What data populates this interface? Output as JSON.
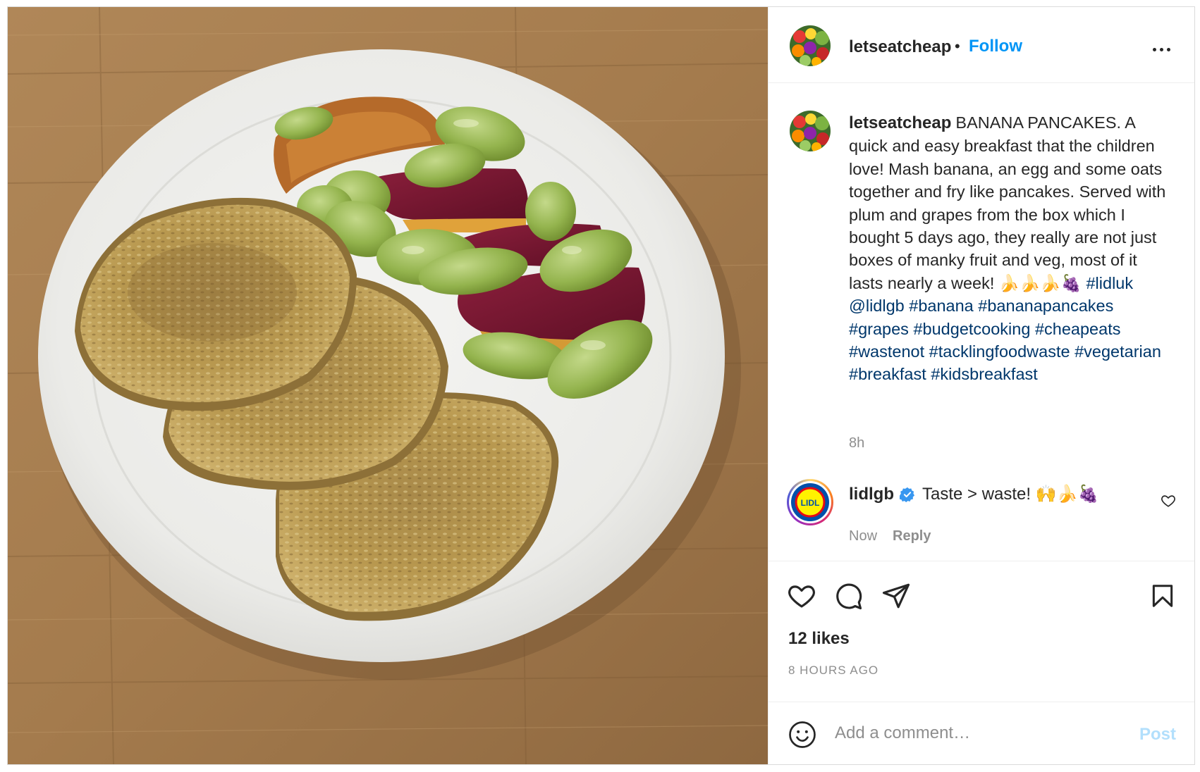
{
  "post": {
    "username": "letseatcheap",
    "dot": "•",
    "follow_label": "Follow",
    "more_icon": "more-horizontal-icon",
    "photo_subject": "banana-oat-pancakes-with-plum-and-grapes"
  },
  "caption": {
    "username": "letseatcheap",
    "text": "BANANA PANCAKES. A quick and easy breakfast that the children love! Mash banana, an egg and some oats together and fry like pancakes. Served with plum and grapes from the box which I bought 5 days ago, they really are not just boxes of manky fruit and veg, most of it lasts nearly a week! 🍌🍌🍌🍇",
    "tags": [
      "#lidluk",
      "@lidlgb",
      "#banana",
      "#bananapancakes",
      "#grapes",
      "#budgetcooking",
      "#cheapeats",
      "#wastenot",
      "#tacklingfoodwaste",
      "#vegetarian",
      "#breakfast",
      "#kidsbreakfast"
    ],
    "time_ago": "8h"
  },
  "comment": {
    "username": "lidlgb",
    "avatar_text": "LIDL",
    "verified_icon": "verified-badge-icon",
    "text": "Taste > waste! 🙌🍌🍇",
    "time": "Now",
    "reply_label": "Reply"
  },
  "actions": {
    "like_icon": "heart-icon",
    "comment_icon": "comment-icon",
    "share_icon": "paper-plane-icon",
    "save_icon": "bookmark-icon",
    "likes": "12 likes",
    "timestamp": "8 HOURS AGO"
  },
  "composer": {
    "emoji_icon": "smiley-icon",
    "placeholder": "Add a comment…",
    "post_label": "Post"
  },
  "colors": {
    "link_blue": "#0095f6",
    "tag_blue": "#00376b",
    "verified_blue": "#3897f0",
    "post_disabled": "#b2dffc",
    "secondary_text": "#8e8e8e"
  }
}
